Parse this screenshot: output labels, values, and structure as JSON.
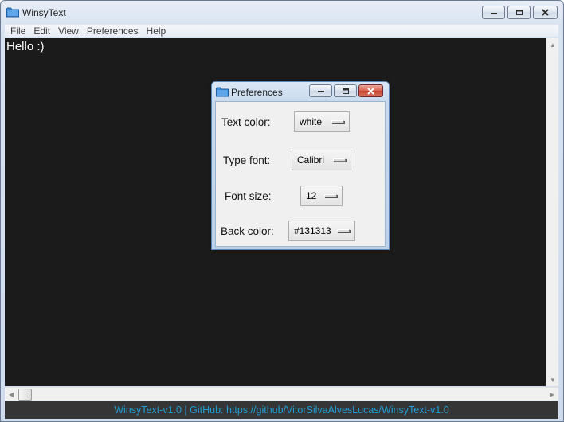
{
  "window": {
    "title": "WinsyText",
    "icon": "folder-icon"
  },
  "menu": [
    "File",
    "Edit",
    "View",
    "Preferences",
    "Help"
  ],
  "editor": {
    "content": "Hello :)",
    "background": "#1b1b1b",
    "text_color": "#ffffff"
  },
  "statusbar": {
    "text": "WinsyText-v1.0 | GitHub: https://github/VitorSilvaAlvesLucas/WinsyText-v1.0",
    "color": "#1e9fd8"
  },
  "preferences": {
    "title": "Preferences",
    "rows": [
      {
        "label": "Text color:",
        "value": "white"
      },
      {
        "label": "Type font:",
        "value": "Calibri"
      },
      {
        "label": "Font size:",
        "value": "12"
      },
      {
        "label": "Back color:",
        "value": "#131313"
      }
    ]
  }
}
